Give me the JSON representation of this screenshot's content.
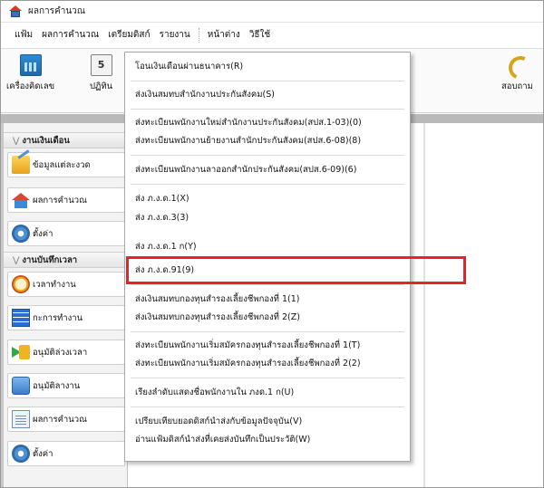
{
  "window": {
    "title": "ผลการคำนวณ"
  },
  "menubar": {
    "items": [
      "แฟ้ม",
      "ผลการคำนวณ",
      "เตรียมดิสก์",
      "รายงาน",
      "หน้าต่าง",
      "วิธีใช้"
    ]
  },
  "toolbar": {
    "calculator_label": "เครื่องคิดเลข",
    "calendar_label": "ปฏิทิน",
    "calendar_day": "5",
    "help_label": "สอบถาม"
  },
  "left_panel": {
    "payroll_section": "งานเงินเดือน",
    "payroll_items": [
      "ข้อมูลแต่ละงวด",
      "ผลการคำนวณ",
      "ตั้งค่า"
    ],
    "time_section": "งานบันทึกเวลา",
    "time_items": [
      "เวลาทำงาน",
      "กะการทำงาน",
      "อนุมัติล่วงเวลา",
      "อนุมัติลางาน",
      "ผลการคำนวณ",
      "ตั้งค่า"
    ]
  },
  "dropdown": {
    "items": [
      "โอนเงินเดือนผ่านธนาคาร(R)",
      "ส่งเงินสมทบสำนักงานประกันสังคม(S)",
      "ส่งทะเบียนพนักงานใหม่สำนักงานประกันสังคม(สปส.1-03)(0)",
      "ส่งทะเบียนพนักงานย้ายงานสำนักประกันสังคม(สปส.6-08)(8)",
      "ส่งทะเบียนพนักงานลาออกสำนักประกันสังคม(สปส.6-09)(6)",
      "ส่ง ภ.ง.ด.1(X)",
      "ส่ง ภ.ง.ด.3(3)",
      "ส่ง ภ.ง.ด.1 ก(Y)",
      "ส่ง ภ.ง.ด.91(9)",
      "ส่งเงินสมทบกองทุนสำรองเลี้ยงชีพกองที่ 1(1)",
      "ส่งเงินสมทบกองทุนสำรองเลี้ยงชีพกองที่ 2(Z)",
      "ส่งทะเบียนพนักงานเริ่มสมัครกองทุนสำรองเลี้ยงชีพกองที่ 1(T)",
      "ส่งทะเบียนพนักงานเริ่มสมัครกองทุนสำรองเลี้ยงชีพกองที่ 2(2)",
      "เรียงลำดับแสดงชื่อพนักงานใน ภงด.1 ก(U)",
      "เปรียบเทียบยอดดิสก์นำส่งกับข้อมูลปัจจุบัน(V)",
      "อ่านแฟ้มดิสก์นำส่งที่เคยส่งบันทึกเป็นประวัติ(W)"
    ],
    "highlighted_item": "ส่ง ภ.ง.ด.91(9)"
  },
  "colors": {
    "highlight_border": "#e4242a",
    "menu_bg": "#ffffff",
    "panel_bg": "#f3f3f3"
  }
}
